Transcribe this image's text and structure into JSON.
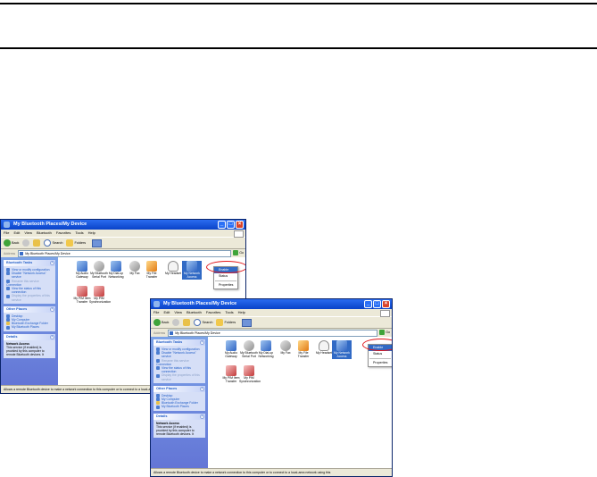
{
  "window_title": "My Bluetooth Places/My Device",
  "menu": [
    "File",
    "Edit",
    "View",
    "Bluetooth",
    "Favorites",
    "Tools",
    "Help"
  ],
  "toolbar": {
    "back": "Back",
    "search": "Search",
    "folders": "Folders"
  },
  "address": {
    "label": "Address",
    "value": "My Bluetooth Places\\My Device",
    "go": "Go"
  },
  "bluetooth_tasks": {
    "title": "Bluetooth Tasks",
    "items": [
      {
        "label": "View or modify configuration",
        "state": "link"
      },
      {
        "label": "Disable \"Network Access\" service",
        "state": "link"
      },
      {
        "label": "Rename this service",
        "state": "muted"
      },
      {
        "label": "Connection",
        "state": "link"
      },
      {
        "label": "View the status of this connection",
        "state": "link"
      },
      {
        "label": "Display the properties of this service",
        "state": "muted"
      }
    ]
  },
  "other_places": {
    "title": "Other Places",
    "items": [
      {
        "label": "Desktop"
      },
      {
        "label": "My Computer"
      },
      {
        "label": "Bluetooth Exchange Folder"
      },
      {
        "label": "My Bluetooth Places"
      }
    ]
  },
  "details": {
    "title": "Details",
    "heading": "Network Access",
    "text": "This service (if enabled) is provided by this computer to remote Bluetooth devices. It"
  },
  "services": [
    {
      "label": "My Audio Gateway",
      "icon": "audio-gateway-icon",
      "color": "blue"
    },
    {
      "label": "My Bluetooth Serial Port",
      "icon": "serial-port-icon",
      "color": "grey"
    },
    {
      "label": "My Dial-up Networking",
      "icon": "dialup-networking-icon",
      "color": "blue"
    },
    {
      "label": "My Fax",
      "icon": "fax-icon",
      "color": "grey"
    },
    {
      "label": "My File Transfer",
      "icon": "file-transfer-icon",
      "color": "orange"
    },
    {
      "label": "My Headset",
      "icon": "headset-icon",
      "color": "white"
    },
    {
      "label": "My Network Access",
      "icon": "network-access-icon",
      "color": "blue"
    },
    {
      "label": "My PIM Item Transfer",
      "icon": "pim-item-transfer-icon",
      "color": "red"
    },
    {
      "label": "My PIM Synchronization",
      "icon": "pim-synchronization-icon",
      "color": "red"
    }
  ],
  "context_menu": {
    "items": [
      "Enable",
      "Status",
      "Properties"
    ],
    "selected": "Enable"
  },
  "status_bar": "Allows a remote Bluetooth device to make a network connection to this computer or to connect to a local-area network using this",
  "colors": {
    "titlebar": "#0a43c8",
    "highlight": "#e0171b",
    "panel": "#6375d6"
  }
}
